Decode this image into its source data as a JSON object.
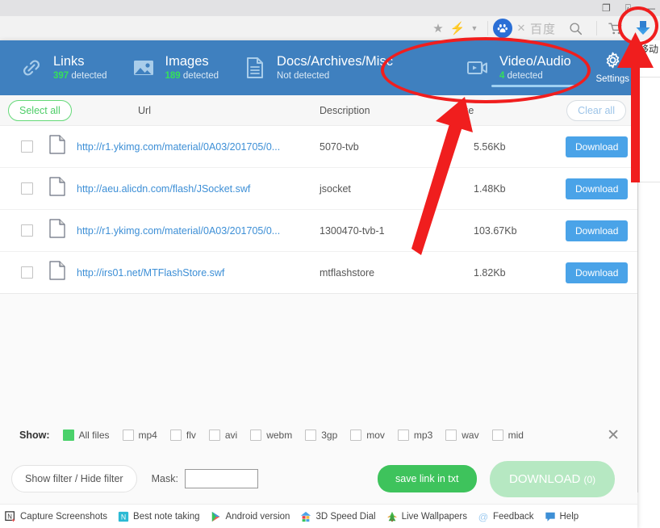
{
  "browser": {
    "window_controls": [
      "restore-icon",
      "pin-icon",
      "minimize-icon"
    ],
    "toolbar": {
      "star": "★",
      "bolt": "⚡",
      "caret": "▾",
      "baidu_logo_text": "百",
      "close_mark": "✕",
      "engine_label": "百度",
      "search": "search-icon",
      "cart": "cart-icon",
      "download": "download-icon"
    },
    "background_text": "移动"
  },
  "tabs": [
    {
      "name": "links",
      "title": "Links",
      "count": "397",
      "detected": "detected",
      "active": false,
      "icon": "link-chain-icon"
    },
    {
      "name": "images",
      "title": "Images",
      "count": "189",
      "detected": "detected",
      "active": false,
      "icon": "image-icon"
    },
    {
      "name": "docs",
      "title": "Docs/Archives/Misc",
      "count": "",
      "detected": "Not detected",
      "active": false,
      "icon": "document-icon"
    },
    {
      "name": "video_audio",
      "title": "Video/Audio",
      "count": "4",
      "detected": "detected",
      "active": true,
      "icon": "video-camera-icon"
    }
  ],
  "settings": {
    "label": "Settings",
    "icon": "gear-icon"
  },
  "table": {
    "select_all_label": "Select all",
    "clear_all_label": "Clear all",
    "columns": {
      "url": "Url",
      "description": "Description",
      "size": "Size"
    },
    "rows": [
      {
        "url": "http://r1.ykimg.com/material/0A03/201705/0...",
        "description": "5070-tvb",
        "size": "5.56Kb",
        "download_label": "Download",
        "checked": false
      },
      {
        "url": "http://aeu.alicdn.com/flash/JSocket.swf",
        "description": "jsocket",
        "size": "1.48Kb",
        "download_label": "Download",
        "checked": false
      },
      {
        "url": "http://r1.ykimg.com/material/0A03/201705/0...",
        "description": "1300470-tvb-1",
        "size": "103.67Kb",
        "download_label": "Download",
        "checked": false
      },
      {
        "url": "http://irs01.net/MTFlashStore.swf",
        "description": "mtflashstore",
        "size": "1.82Kb",
        "download_label": "Download",
        "checked": false
      }
    ]
  },
  "filters": {
    "show_label": "Show:",
    "close_icon": "close-icon",
    "items": [
      {
        "label": "All files",
        "checked": true
      },
      {
        "label": "mp4",
        "checked": false
      },
      {
        "label": "flv",
        "checked": false
      },
      {
        "label": "avi",
        "checked": false
      },
      {
        "label": "webm",
        "checked": false
      },
      {
        "label": "3gp",
        "checked": false
      },
      {
        "label": "mov",
        "checked": false
      },
      {
        "label": "mp3",
        "checked": false
      },
      {
        "label": "wav",
        "checked": false
      },
      {
        "label": "mid",
        "checked": false
      }
    ]
  },
  "actions": {
    "filter_toggle_label": "Show filter / Hide filter",
    "mask_label": "Mask:",
    "mask_value": "",
    "mask_placeholder": "",
    "save_link_label": "save link in txt",
    "download_label": "DOWNLOAD",
    "download_count": "(0)"
  },
  "footer": {
    "links": [
      {
        "label": "Capture Screenshots",
        "icon": "nimbus-capture-icon"
      },
      {
        "label": "Best note taking",
        "icon": "note-icon"
      },
      {
        "label": "Android version",
        "icon": "google-play-icon"
      },
      {
        "label": "3D Speed Dial",
        "icon": "house-icon"
      },
      {
        "label": "Live Wallpapers",
        "icon": "wallpaper-icon"
      },
      {
        "label": "Feedback",
        "icon": "at-icon"
      },
      {
        "label": "Help",
        "icon": "chat-bubble-icon"
      }
    ]
  },
  "colors": {
    "header_blue": "#3f80bf",
    "accent_green": "#3ec35c",
    "detected_green": "#35e05a",
    "link_blue": "#3d8fd6",
    "download_btn": "#4aa3e8",
    "annotation_red": "#f01e1e"
  }
}
